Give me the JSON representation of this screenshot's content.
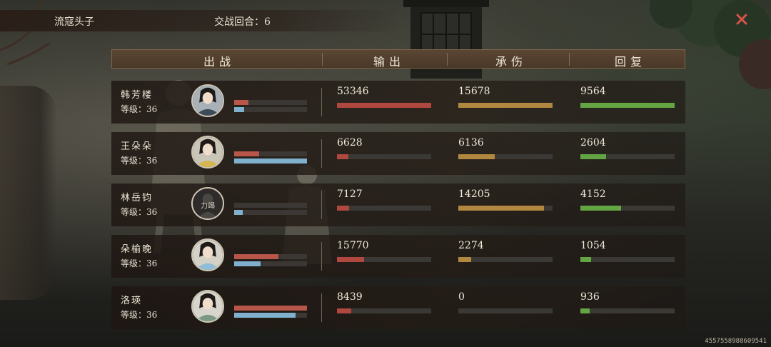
{
  "top": {
    "enemy_name": "流寇头子",
    "round_label": "交战回合：6"
  },
  "header": {
    "col_fighter": "出战",
    "col_output": "输出",
    "col_damage_taken": "承伤",
    "col_heal": "回复"
  },
  "players": [
    {
      "name": "韩芳楼",
      "level": "等级：36",
      "avatar": "male-swordsman-portrait",
      "hp": 0.2,
      "mp": 0.14,
      "output": "53346",
      "output_fill": 1.0,
      "taken": "15678",
      "taken_fill": 1.0,
      "heal": "9564",
      "heal_fill": 1.0
    },
    {
      "name": "王朵朵",
      "level": "等级：36",
      "avatar": "girl-yellow-hat-portrait",
      "hp": 0.34,
      "mp": 1.0,
      "output": "6628",
      "output_fill": 0.12,
      "taken": "6136",
      "taken_fill": 0.39,
      "heal": "2604",
      "heal_fill": 0.27
    },
    {
      "name": "林岳钧",
      "level": "等级：36",
      "avatar": "dark-exhausted-portrait",
      "avatar_text": "力竭",
      "hp": 0.0,
      "mp": 0.12,
      "output": "7127",
      "output_fill": 0.13,
      "taken": "14205",
      "taken_fill": 0.91,
      "heal": "4152",
      "heal_fill": 0.43
    },
    {
      "name": "朵榆晚",
      "level": "等级：36",
      "avatar": "lady-blue-robe-portrait",
      "hp": 0.61,
      "mp": 0.36,
      "output": "15770",
      "output_fill": 0.29,
      "taken": "2274",
      "taken_fill": 0.14,
      "heal": "1054",
      "heal_fill": 0.11
    },
    {
      "name": "洛瑛",
      "level": "等级：36",
      "avatar": "lady-green-robe-portrait",
      "hp": 1.0,
      "mp": 0.84,
      "output": "8439",
      "output_fill": 0.15,
      "taken": "0",
      "taken_fill": 0.0,
      "heal": "936",
      "heal_fill": 0.1
    }
  ],
  "colors": {
    "output_bar": "#b04840",
    "taken_bar": "#b2873f",
    "heal_bar": "#64a543",
    "hp_bar": "#b8564a",
    "mp_bar": "#7fb0cd",
    "header_bg": "#5a4634",
    "close_icon": "#d9534a"
  },
  "user_id": "4557558988609541"
}
